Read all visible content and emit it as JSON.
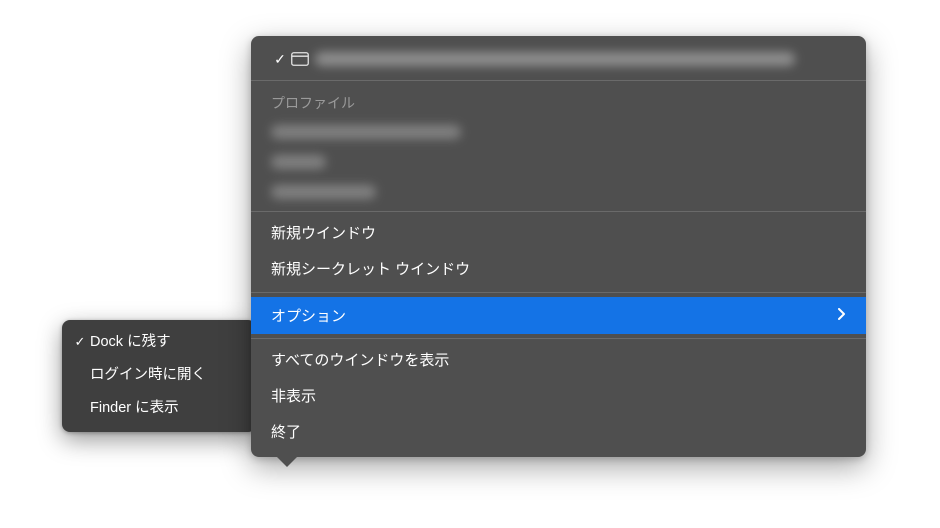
{
  "colors": {
    "highlight": "#1473e6",
    "menu_bg": "#4f4f4f",
    "submenu_bg": "#3f3f3f"
  },
  "main_menu": {
    "window_row": {
      "checked": true
    },
    "profile_header": "プロファイル",
    "actions_group1": {
      "new_window": "新規ウインドウ",
      "new_incognito": "新規シークレット ウインドウ"
    },
    "options": {
      "label": "オプション",
      "highlighted": true
    },
    "actions_group2": {
      "show_all_windows": "すべてのウインドウを表示",
      "hide": "非表示",
      "quit": "終了"
    }
  },
  "submenu": {
    "items": [
      {
        "label": "Dock に残す",
        "checked": true
      },
      {
        "label": "ログイン時に開く",
        "checked": false
      },
      {
        "label": "Finder に表示",
        "checked": false
      }
    ]
  }
}
